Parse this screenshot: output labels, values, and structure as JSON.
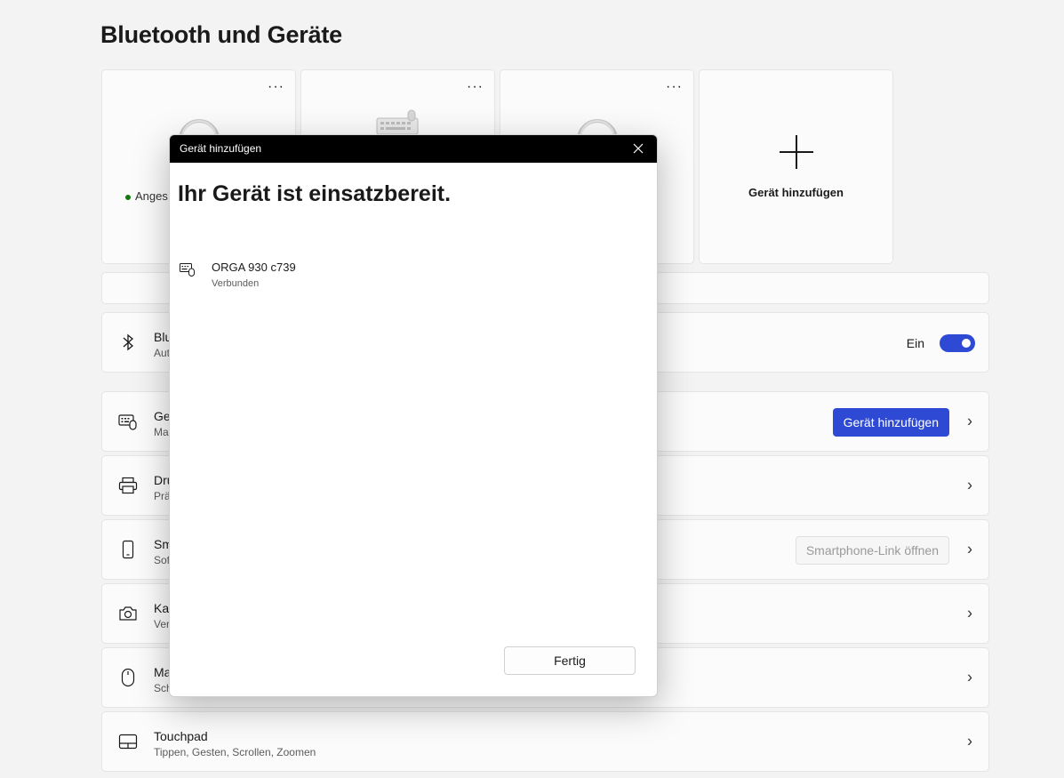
{
  "page": {
    "title": "Bluetooth und Geräte"
  },
  "cards": [
    {
      "more": "···",
      "status": "Anges"
    },
    {
      "more": "···"
    },
    {
      "more": "···"
    },
    {
      "add_label": "Gerät hinzufügen"
    }
  ],
  "rows": {
    "bluetooth": {
      "title": "Blu",
      "subtitle": "Aut",
      "toggle_label": "Ein",
      "toggle_on": true
    },
    "devices": {
      "title": "Ge",
      "subtitle": "Ma",
      "button": "Gerät hinzufügen"
    },
    "printers": {
      "title": "Dru",
      "subtitle": "Prä"
    },
    "phone": {
      "title": "Sm",
      "subtitle": "Sof",
      "button": "Smartphone-Link öffnen"
    },
    "camera": {
      "title": "Ka",
      "subtitle": "Ver"
    },
    "mouse": {
      "title": "Ma",
      "subtitle": "Sch"
    },
    "touchpad": {
      "title": "Touchpad",
      "subtitle": "Tippen, Gesten, Scrollen, Zoomen"
    }
  },
  "dialog": {
    "title": "Gerät hinzufügen",
    "heading": "Ihr Gerät ist einsatzbereit.",
    "device_name": "ORGA 930 c739",
    "device_status": "Verbunden",
    "done_button": "Fertig"
  },
  "colors": {
    "accent": "#2e4ad5",
    "status_connected": "#0f7b0f",
    "dialog_titlebar": "#000000"
  },
  "icons": [
    "bluetooth-icon",
    "keyboard-icon",
    "printer-icon",
    "smartphone-icon",
    "camera-icon",
    "mouse-icon",
    "touchpad-icon",
    "close-icon",
    "plus-icon",
    "chevron-right-icon",
    "headphones-icon"
  ]
}
